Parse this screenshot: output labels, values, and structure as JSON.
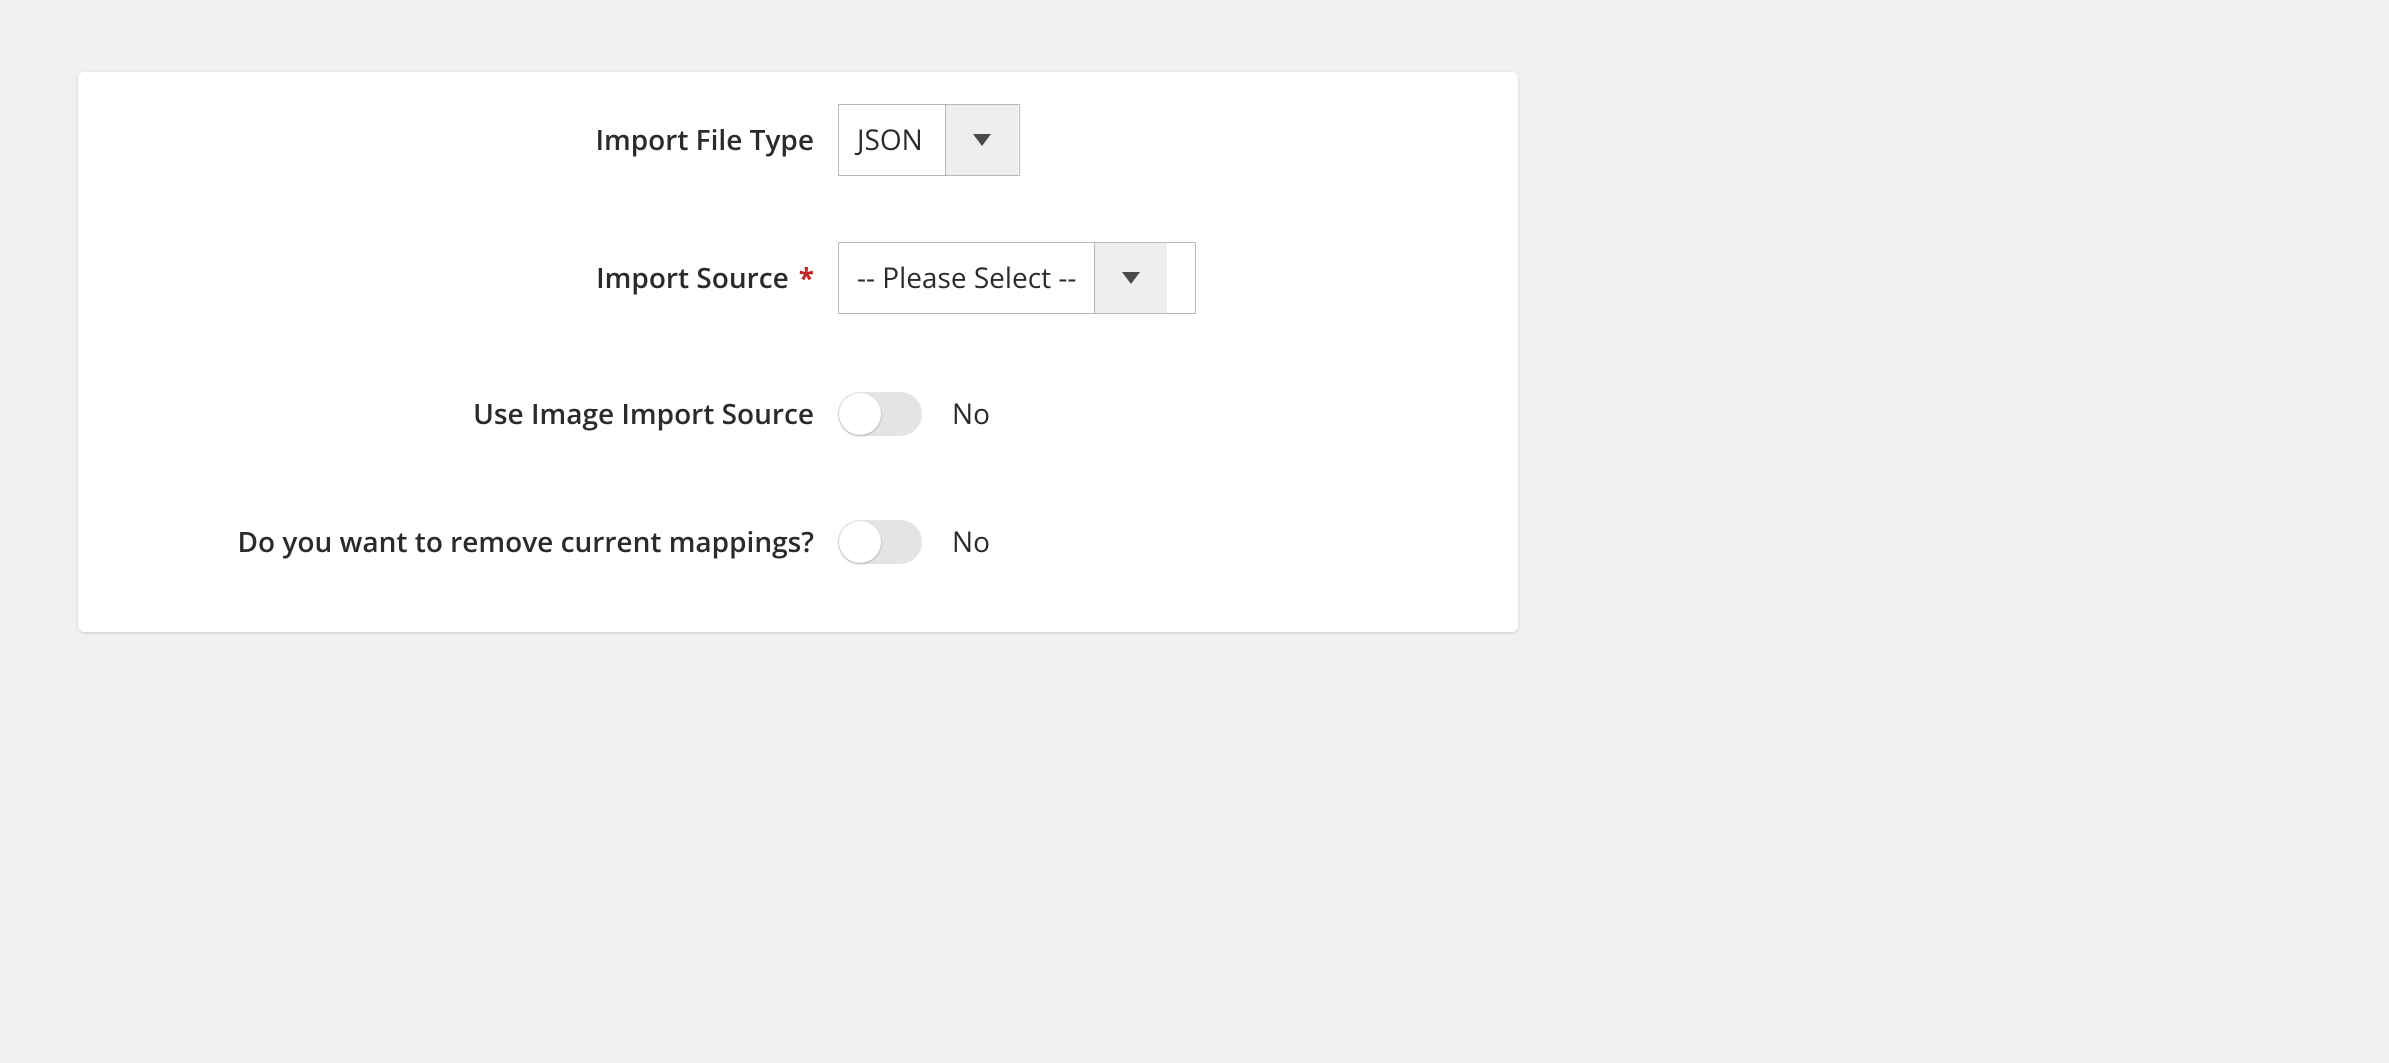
{
  "fields": {
    "file_type": {
      "label": "Import File Type",
      "value": "JSON",
      "required": false
    },
    "import_source": {
      "label": "Import Source",
      "value": "-- Please Select --",
      "required": true
    },
    "use_image_import_source": {
      "label": "Use Image Import Source",
      "state_text": "No"
    },
    "remove_mappings": {
      "label": "Do you want to remove current mappings?",
      "state_text": "No"
    }
  }
}
